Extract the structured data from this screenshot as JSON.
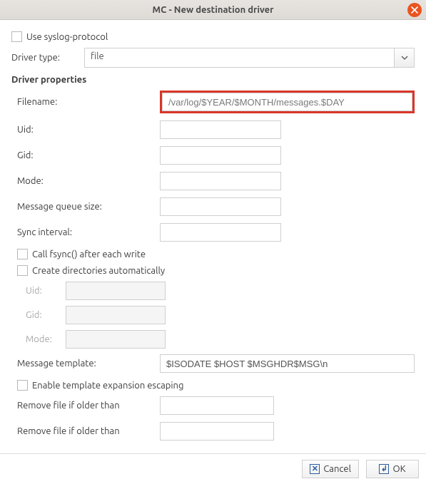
{
  "window": {
    "title": "MC - New destination driver"
  },
  "top": {
    "syslog_protocol_label": "Use syslog-protocol",
    "driver_type_label": "Driver type:",
    "driver_type_value": "file"
  },
  "section_title": "Driver properties",
  "props": {
    "filename_label": "Filename:",
    "filename_value": "/var/log/$YEAR/$MONTH/messages.$DAY",
    "uid_label": "Uid:",
    "uid_value": "",
    "gid_label": "Gid:",
    "gid_value": "",
    "mode_label": "Mode:",
    "mode_value": "",
    "mqs_label": "Message queue size:",
    "mqs_value": "",
    "sync_label": "Sync interval:",
    "sync_value": "",
    "fsync_label": "Call fsync() after each write",
    "mkdir_label": "Create directories automatically",
    "sub_uid_label": "Uid:",
    "sub_uid_value": "",
    "sub_gid_label": "Gid:",
    "sub_gid_value": "",
    "sub_mode_label": "Mode:",
    "sub_mode_value": "",
    "template_label": "Message template:",
    "template_value": "$ISODATE $HOST $MSGHDR$MSG\\n",
    "escape_label": "Enable template expansion escaping",
    "remove_older_1_label": "Remove file if older than",
    "remove_older_1_value": "",
    "remove_older_2_label": "Remove file if older than",
    "remove_older_2_value": ""
  },
  "buttons": {
    "cancel": "Cancel",
    "ok": "OK"
  }
}
